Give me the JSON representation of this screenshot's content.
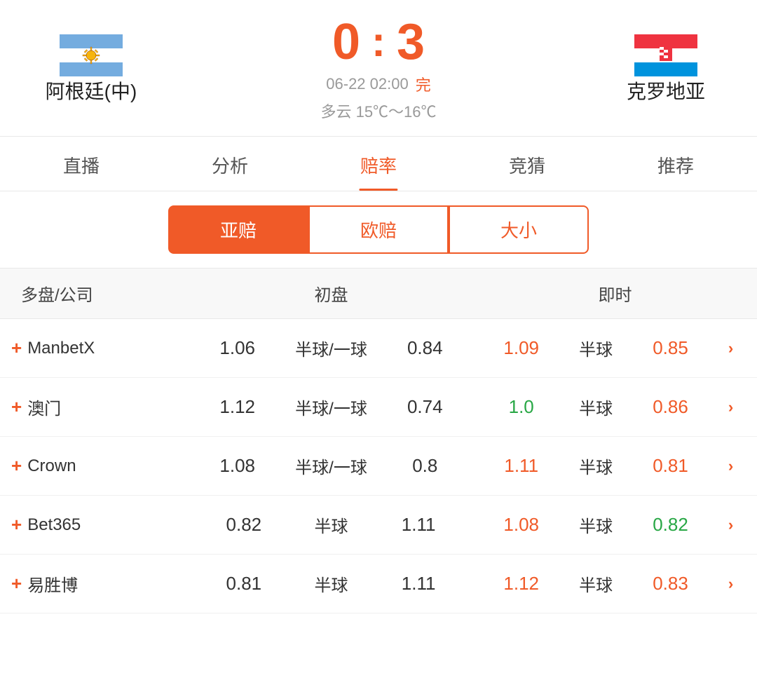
{
  "header": {
    "team_home": "阿根廷(中)",
    "team_away": "克罗地亚",
    "score_home": "0",
    "score_colon": ":",
    "score_away": "3",
    "match_date": "06-22 02:00",
    "match_status": "完",
    "weather": "多云  15℃～16℃"
  },
  "tabs": [
    {
      "label": "直播",
      "active": false
    },
    {
      "label": "分析",
      "active": false
    },
    {
      "label": "赔率",
      "active": true
    },
    {
      "label": "竞猜",
      "active": false
    },
    {
      "label": "推荐",
      "active": false
    }
  ],
  "sub_tabs": [
    {
      "label": "亚赔",
      "active": true
    },
    {
      "label": "欧赔",
      "active": false
    },
    {
      "label": "大小",
      "active": false
    }
  ],
  "table_header": {
    "col1": "多盘/公司",
    "col2": "初盘",
    "col3": "即时"
  },
  "odds_rows": [
    {
      "company": "ManbetX",
      "init_val1": "1.06",
      "init_handicap": "半球/一球",
      "init_val2": "0.84",
      "live_val1": "1.09",
      "live_val1_color": "orange",
      "live_handicap": "半球",
      "live_val2": "0.85",
      "live_val2_color": "orange"
    },
    {
      "company": "澳门",
      "init_val1": "1.12",
      "init_handicap": "半球/一球",
      "init_val2": "0.74",
      "live_val1": "1.0",
      "live_val1_color": "green",
      "live_handicap": "半球",
      "live_val2": "0.86",
      "live_val2_color": "orange"
    },
    {
      "company": "Crown",
      "init_val1": "1.08",
      "init_handicap": "半球/一球",
      "init_val2": "0.8",
      "live_val1": "1.11",
      "live_val1_color": "orange",
      "live_handicap": "半球",
      "live_val2": "0.81",
      "live_val2_color": "orange"
    },
    {
      "company": "Bet365",
      "init_val1": "0.82",
      "init_handicap": "半球",
      "init_val2": "1.11",
      "live_val1": "1.08",
      "live_val1_color": "orange",
      "live_handicap": "半球",
      "live_val2": "0.82",
      "live_val2_color": "green"
    },
    {
      "company": "易胜博",
      "init_val1": "0.81",
      "init_handicap": "半球",
      "init_val2": "1.11",
      "live_val1": "1.12",
      "live_val1_color": "orange",
      "live_handicap": "半球",
      "live_val2": "0.83",
      "live_val2_color": "orange"
    }
  ]
}
